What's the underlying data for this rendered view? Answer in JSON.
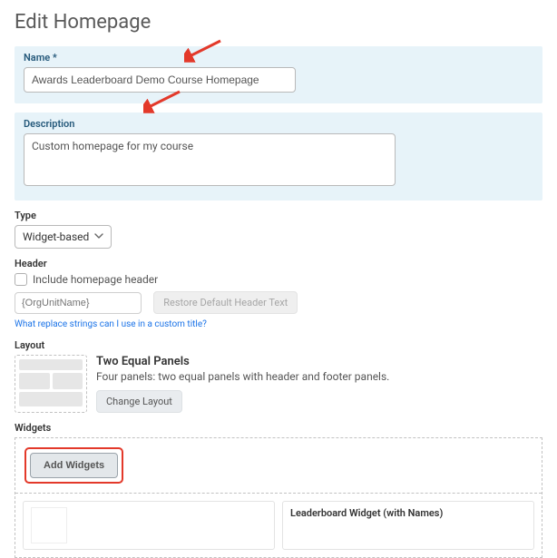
{
  "page": {
    "title": "Edit Homepage"
  },
  "form": {
    "name_label": "Name *",
    "name_value": "Awards Leaderboard Demo Course Homepage",
    "desc_label": "Description",
    "desc_value": "Custom homepage for my course"
  },
  "type": {
    "label": "Type",
    "selected": "Widget-based"
  },
  "header": {
    "label": "Header",
    "checkbox_label": "Include homepage header",
    "input_placeholder": "{OrgUnitName}",
    "restore_button": "Restore Default Header Text",
    "help_link": "What replace strings can I use in a custom title?"
  },
  "layout": {
    "label": "Layout",
    "title": "Two Equal Panels",
    "desc": "Four panels: two equal panels with header and footer panels.",
    "change_button": "Change Layout"
  },
  "widgets": {
    "label": "Widgets",
    "add_button": "Add Widgets",
    "panel2_title": "Leaderboard Widget (with Names)"
  }
}
